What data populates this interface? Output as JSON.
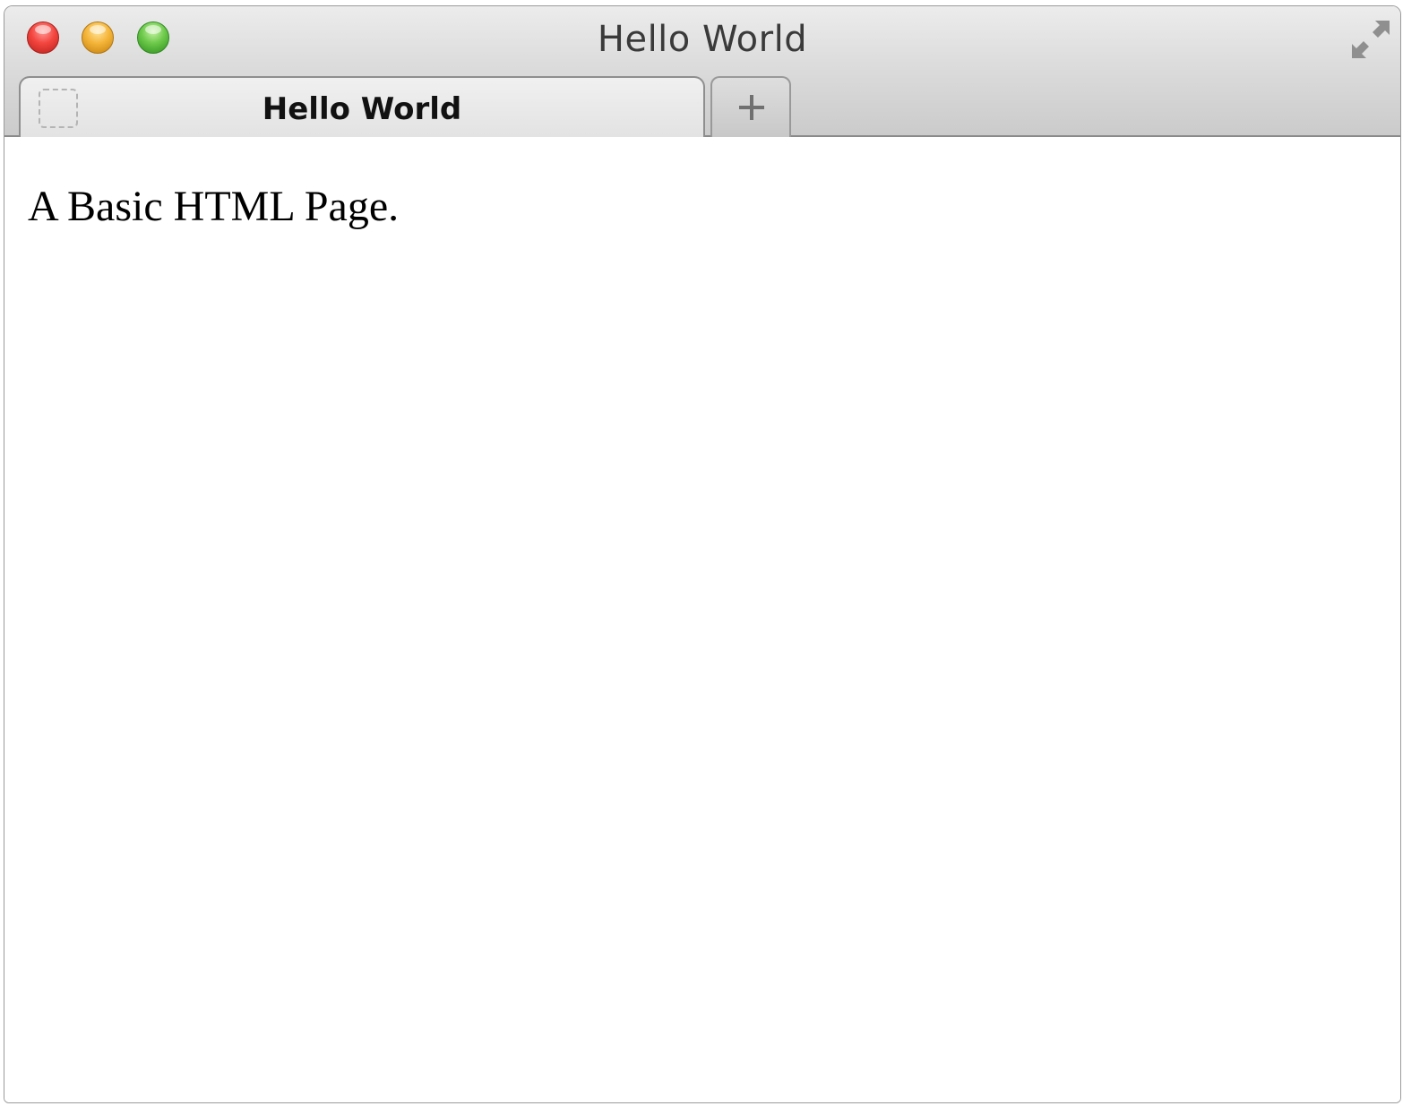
{
  "window": {
    "title": "Hello World"
  },
  "tabs": [
    {
      "label": "Hello World",
      "active": true
    }
  ],
  "new_tab": {
    "icon": "plus-icon"
  },
  "page": {
    "text": "A Basic HTML Page."
  },
  "colors": {
    "close": "#f4453f",
    "minimize": "#f5b53a",
    "zoom": "#6cc94a"
  }
}
